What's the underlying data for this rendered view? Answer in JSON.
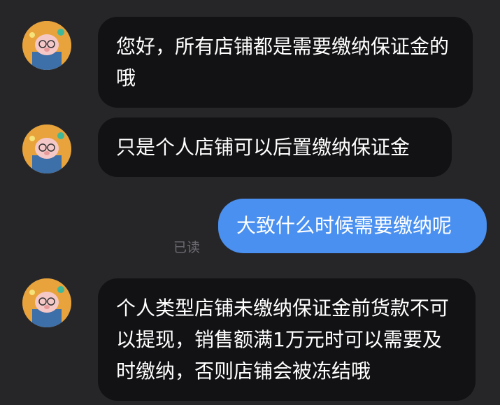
{
  "messages": [
    {
      "sender": "other",
      "avatar": "cartoon-pig-avatar",
      "text": "您好，所有店铺都是需要缴纳保证金的哦"
    },
    {
      "sender": "other",
      "avatar": "cartoon-pig-avatar",
      "text": "只是个人店铺可以后置缴纳保证金"
    },
    {
      "sender": "self",
      "text": "大致什么时候需要缴纳呢",
      "status": "已读"
    },
    {
      "sender": "other",
      "avatar": "cartoon-pig-avatar",
      "text": "个人类型店铺未缴纳保证金前货款不可以提现，销售额满1万元时可以需要及时缴纳，否则店铺会被冻结哦"
    }
  ],
  "colors": {
    "background": "#262629",
    "incoming_bubble": "#121214",
    "outgoing_bubble": "#4a90f0",
    "avatar_bg": "#e8a33c"
  }
}
